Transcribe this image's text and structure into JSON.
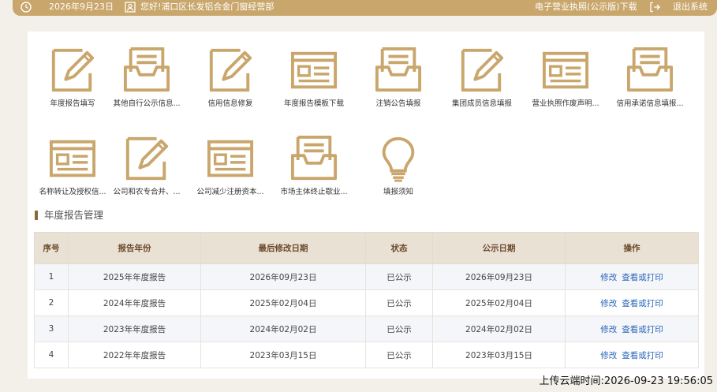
{
  "header": {
    "date": "2026年9月23日",
    "greeting": "您好!浦口区长发铝合金门窗经营部",
    "license_link": "电子营业执照(公示版)下载",
    "logout": "退出系统"
  },
  "icons": [
    {
      "label": "年度报告填写",
      "icon": "pencil-icon"
    },
    {
      "label": "其他自行公示信息...",
      "icon": "inbox-icon"
    },
    {
      "label": "信用信息修复",
      "icon": "pencil-icon"
    },
    {
      "label": "年度报告模板下载",
      "icon": "browser-icon"
    },
    {
      "label": "注销公告填报",
      "icon": "inbox-icon"
    },
    {
      "label": "集团成员信息填报",
      "icon": "pencil-icon"
    },
    {
      "label": "营业执照作废声明...",
      "icon": "browser-icon"
    },
    {
      "label": "信用承诺信息填报...",
      "icon": "inbox-icon"
    },
    {
      "label": "名称转让及授权信...",
      "icon": "browser-icon"
    },
    {
      "label": "公司和农专合并、...",
      "icon": "pencil-icon"
    },
    {
      "label": "公司减少注册资本...",
      "icon": "browser-icon"
    },
    {
      "label": "市场主体终止歇业...",
      "icon": "inbox-icon"
    },
    {
      "label": "填报须知",
      "icon": "lightbulb-icon"
    }
  ],
  "section": {
    "title": "年度报告管理"
  },
  "table": {
    "headers": [
      "序号",
      "报告年份",
      "最后修改日期",
      "状态",
      "公示日期",
      "操作"
    ],
    "rows": [
      [
        "1",
        "2025年年度报告",
        "2026年09月23日",
        "已公示",
        "2026年09月23日"
      ],
      [
        "2",
        "2024年年度报告",
        "2025年02月04日",
        "已公示",
        "2025年02月04日"
      ],
      [
        "3",
        "2023年年度报告",
        "2024年02月02日",
        "已公示",
        "2024年02月02日"
      ],
      [
        "4",
        "2022年年度报告",
        "2023年03月15日",
        "已公示",
        "2023年03月15日"
      ]
    ],
    "actions": {
      "edit": "修改",
      "view": "查看或打印"
    }
  },
  "footer": {
    "upload_time": "上传云端时间:2026-09-23 19:56:05"
  },
  "colors": {
    "accent": "#c9a66b",
    "header_bg": "#eae1d5",
    "link": "#2a66b8"
  }
}
